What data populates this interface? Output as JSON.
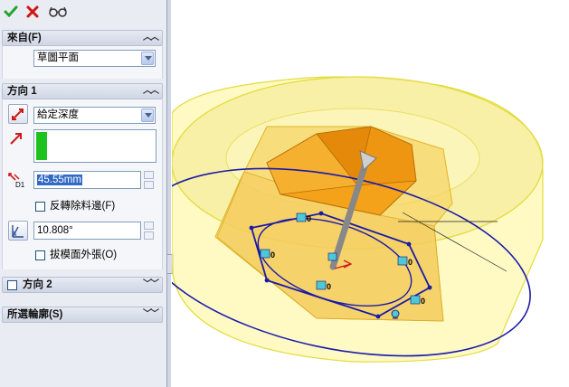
{
  "toolbar": {
    "ok": "ok-icon",
    "cancel": "cancel-icon",
    "preview": "preview-glasses-icon"
  },
  "from": {
    "header": "來自(F)",
    "value": "草圖平面"
  },
  "direction1": {
    "header": "方向 1",
    "end_condition": "給定深度",
    "depth": "45.55mm",
    "depth_icon_label": "D1",
    "flip_side_label": "反轉除料邊(F)",
    "draft_angle": "10.808°",
    "draft_outward_label": "拔模面外張(O)"
  },
  "direction2": {
    "header": "方向 2"
  },
  "selected_contours": {
    "header": "所選輪廓(S)"
  },
  "viewport": {
    "relation_labels": [
      "0",
      "0",
      "0",
      "0",
      "0"
    ],
    "colors": {
      "yellow": "#fff7a8",
      "orange": "#f0a018",
      "blue": "#1a1aa8"
    }
  }
}
